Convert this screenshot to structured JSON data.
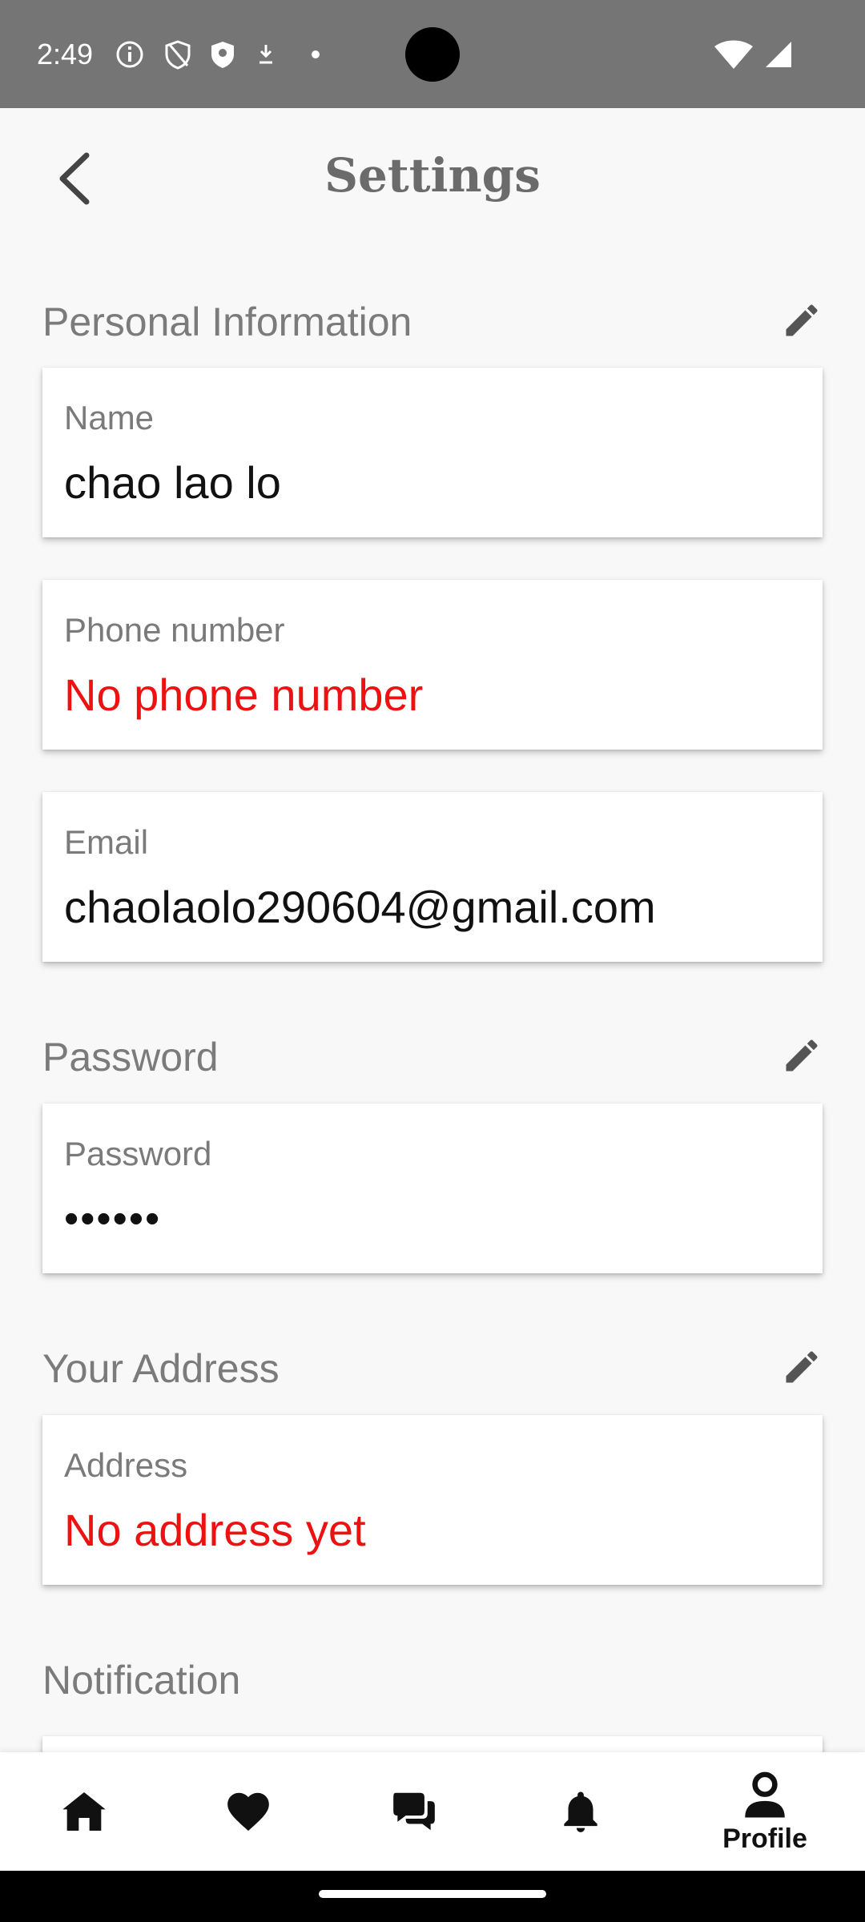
{
  "status_bar": {
    "time": "2:49",
    "icons": [
      "info-icon",
      "shield-outline-icon",
      "shield-filled-icon",
      "download-icon",
      "dot-icon",
      "wifi-icon",
      "signal-icon"
    ]
  },
  "header": {
    "title": "Settings",
    "back_icon": "chevron-left-icon"
  },
  "sections": {
    "personal": {
      "title": "Personal Information",
      "name_label": "Name",
      "name_value": "chao lao lo",
      "phone_label": "Phone number",
      "phone_value": "No phone number",
      "email_label": "Email",
      "email_value": "chaolaolo290604@gmail.com"
    },
    "password": {
      "title": "Password",
      "label": "Password",
      "value": "••••••"
    },
    "address": {
      "title": "Your Address",
      "label": "Address",
      "value": "No address yet"
    },
    "notification": {
      "title": "Notification"
    }
  },
  "bottom_nav": {
    "items": [
      {
        "icon": "home-icon",
        "label": ""
      },
      {
        "icon": "heart-icon",
        "label": ""
      },
      {
        "icon": "chat-icon",
        "label": ""
      },
      {
        "icon": "bell-icon",
        "label": ""
      },
      {
        "icon": "person-icon",
        "label": "Profile"
      }
    ],
    "active": "Profile"
  },
  "colors": {
    "status_bar": "#757575",
    "background": "#f8f8f8",
    "card": "#ffffff",
    "error_text": "#ee1111",
    "label_text": "#7a7a7a",
    "title_text": "#6b6b6b"
  }
}
